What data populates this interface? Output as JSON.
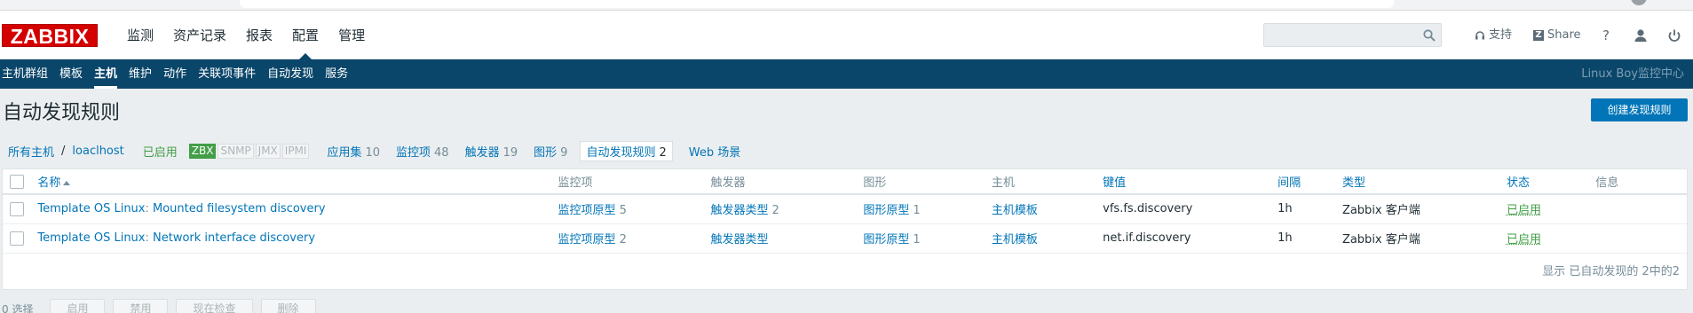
{
  "header": {
    "logo": "ZABBIX",
    "menu": [
      {
        "label": "监测",
        "active": false
      },
      {
        "label": "资产记录",
        "active": false
      },
      {
        "label": "报表",
        "active": false
      },
      {
        "label": "配置",
        "active": true
      },
      {
        "label": "管理",
        "active": false
      }
    ],
    "search_placeholder": "",
    "support_label": "支持",
    "share_label": "Share",
    "help_label": "?"
  },
  "subnav": {
    "items": [
      "主机群组",
      "模板",
      "主机",
      "维护",
      "动作",
      "关联项事件",
      "自动发现",
      "服务"
    ],
    "active_index": 2,
    "brand": "Linux Boy监控中心"
  },
  "page": {
    "title": "自动发现规则",
    "create_button": "创建发现规则"
  },
  "breadcrumb": {
    "all_hosts": "所有主机",
    "separator": "/",
    "host": "loaclhost",
    "status": "已启用",
    "badges": [
      {
        "label": "ZBX",
        "on": true
      },
      {
        "label": "SNMP",
        "on": false
      },
      {
        "label": "JMX",
        "on": false
      },
      {
        "label": "IPMI",
        "on": false
      }
    ],
    "tabs": [
      {
        "label": "应用集",
        "count": "10",
        "active": false
      },
      {
        "label": "监控项",
        "count": "48",
        "active": false
      },
      {
        "label": "触发器",
        "count": "19",
        "active": false
      },
      {
        "label": "图形",
        "count": "9",
        "active": false
      },
      {
        "label": "自动发现规则",
        "count": "2",
        "active": true
      },
      {
        "label": "Web 场景",
        "count": "",
        "active": false
      }
    ]
  },
  "table": {
    "columns": [
      "名称",
      "监控项",
      "触发器",
      "图形",
      "主机",
      "键值",
      "间隔",
      "类型",
      "状态",
      "信息"
    ],
    "rows": [
      {
        "template": "Template OS Linux",
        "name": "Mounted filesystem discovery",
        "items_label": "监控项原型",
        "items_count": "5",
        "triggers_label": "触发器类型",
        "triggers_count": "2",
        "graphs_label": "图形原型",
        "graphs_count": "1",
        "host": "主机模板",
        "key": "vfs.fs.discovery",
        "interval": "1h",
        "type": "Zabbix 客户端",
        "status": "已启用"
      },
      {
        "template": "Template OS Linux",
        "name": "Network interface discovery",
        "items_label": "监控项原型",
        "items_count": "2",
        "triggers_label": "触发器类型",
        "triggers_count": "",
        "graphs_label": "图形原型",
        "graphs_count": "1",
        "host": "主机模板",
        "key": "net.if.discovery",
        "interval": "1h",
        "type": "Zabbix 客户端",
        "status": "已启用"
      }
    ],
    "footer": "显示 已自动发现的 2中的2"
  },
  "actions": {
    "selected": "0 选择",
    "buttons": [
      "启用",
      "禁用",
      "现在检查",
      "删除"
    ]
  }
}
